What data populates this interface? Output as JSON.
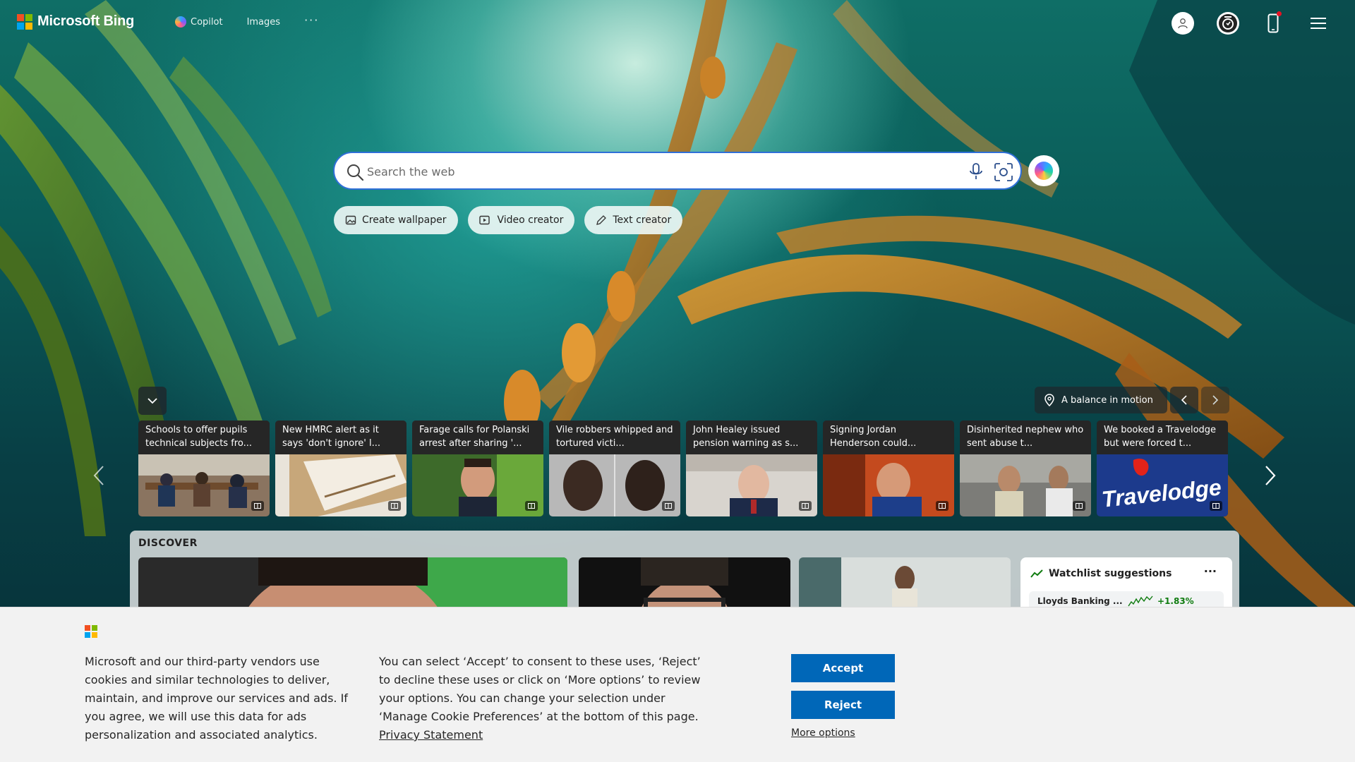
{
  "brand": {
    "name": "Microsoft Bing",
    "logo_colors": [
      "#f25022",
      "#7fba00",
      "#00a4ef",
      "#ffb900"
    ]
  },
  "nav": {
    "items": [
      {
        "label": "Copilot",
        "icon": "copilot-icon"
      },
      {
        "label": "Images",
        "icon": ""
      },
      {
        "label": "···",
        "icon": "more-icon"
      }
    ]
  },
  "header_icons": [
    "account-icon",
    "rewards-icon",
    "mobile-icon",
    "menu-icon"
  ],
  "search": {
    "placeholder": "Search the web",
    "value": "",
    "accent": "#2f6fd8"
  },
  "pills": [
    {
      "label": "Create wallpaper",
      "icon": "wallpaper-icon"
    },
    {
      "label": "Video creator",
      "icon": "video-icon"
    },
    {
      "label": "Text creator",
      "icon": "pen-icon"
    }
  ],
  "image_info": {
    "label": "A balance in motion"
  },
  "news": [
    {
      "title": "Schools to offer pupils technical subjects fro...",
      "image": "classroom"
    },
    {
      "title": "New HMRC alert as it says 'don't ignore' l...",
      "image": "envelope"
    },
    {
      "title": "Farage calls for Polanski arrest after sharing '...",
      "image": "portrait-man"
    },
    {
      "title": "Vile robbers whipped and tortured victi...",
      "image": "two-men"
    },
    {
      "title": "John Healey issued pension warning as s...",
      "image": "man-speaking"
    },
    {
      "title": "Signing Jordan Henderson could...",
      "image": "footballer"
    },
    {
      "title": "Disinherited nephew who sent abuse t...",
      "image": "street-men"
    },
    {
      "title": "We booked a Travelodge but were forced t...",
      "image": "travelodge"
    }
  ],
  "travelodge_text": "Travelodge",
  "discover": {
    "title": "DISCOVER"
  },
  "watchlist": {
    "title": "Watchlist suggestions",
    "more": "···",
    "rows": [
      {
        "name": "Lloyds Banking ...",
        "change": "+1.83%",
        "positive_color": "#107c10"
      }
    ]
  },
  "cookie": {
    "text1": "Microsoft and our third-party vendors use cookies and similar technologies to deliver, maintain, and improve our services and ads. If you agree, we will use this data for ads personalization and associated analytics.",
    "text2": "You can select ‘Accept’ to consent to these uses, ‘Reject’ to decline these uses or click on ‘More options’ to review your options. You can change your selection under ‘Manage Cookie Preferences’ at the bottom of this page.",
    "privacy_link": "Privacy Statement",
    "accept": "Accept",
    "reject": "Reject",
    "more_options": "More options",
    "button_color": "#0067b8"
  }
}
